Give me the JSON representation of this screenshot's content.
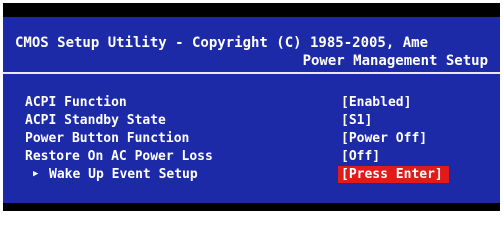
{
  "header": {
    "title": "CMOS Setup Utility - Copyright (C) 1985-2005, Ame",
    "page_title": "Power Management Setup"
  },
  "menu": {
    "items": [
      {
        "label": "ACPI Function",
        "value": "[Enabled]"
      },
      {
        "label": "ACPI Standby State",
        "value": "[S1]"
      },
      {
        "label": "Power Button Function",
        "value": "[Power Off]"
      },
      {
        "label": "Restore On AC Power Loss",
        "value": "[Off]"
      },
      {
        "label": "Wake Up Event Setup",
        "value": "[Press Enter]",
        "marker": "▶",
        "selected": true
      }
    ]
  },
  "colors": {
    "background": "#1c2aa8",
    "text": "#ffffff",
    "highlight": "#e11a1a"
  }
}
